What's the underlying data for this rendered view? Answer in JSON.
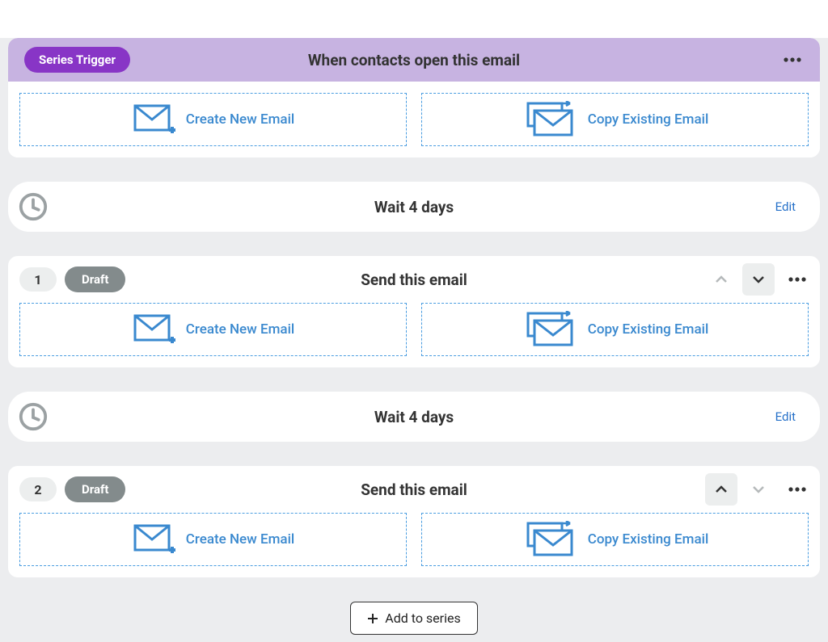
{
  "trigger": {
    "badge": "Series Trigger",
    "title": "When contacts open this email",
    "actions": {
      "create": "Create New Email",
      "copy": "Copy Existing Email"
    }
  },
  "wait1": {
    "title": "Wait 4 days",
    "edit": "Edit"
  },
  "step1": {
    "num": "1",
    "status": "Draft",
    "title": "Send this email",
    "actions": {
      "create": "Create New Email",
      "copy": "Copy Existing Email"
    }
  },
  "wait2": {
    "title": "Wait 4 days",
    "edit": "Edit"
  },
  "step2": {
    "num": "2",
    "status": "Draft",
    "title": "Send this email",
    "actions": {
      "create": "Create New Email",
      "copy": "Copy Existing Email"
    }
  },
  "footer": {
    "add": "Add to series"
  }
}
